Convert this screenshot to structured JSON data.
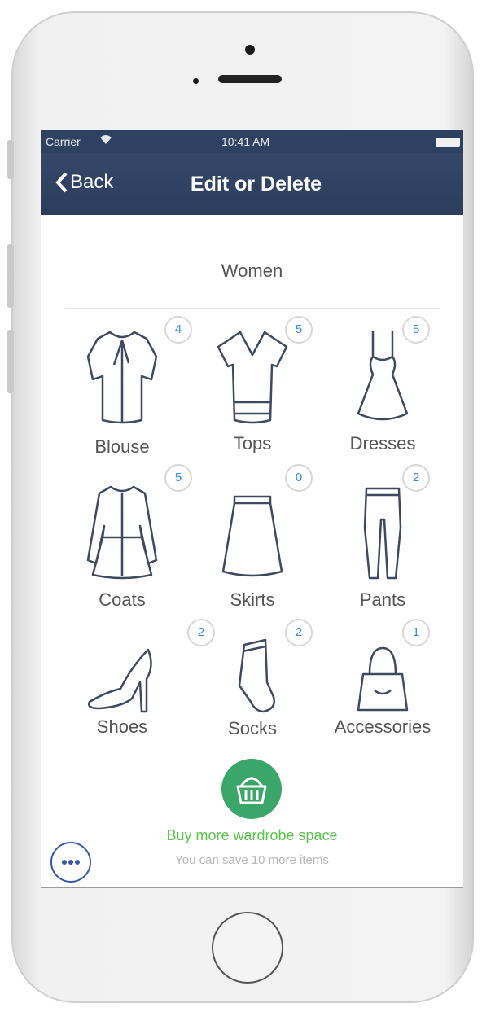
{
  "status": {
    "carrier": "Carrier",
    "wifi_icon": "wifi-icon",
    "time": "10:41 AM",
    "battery_icon": "battery-icon"
  },
  "nav": {
    "back_label": "Back",
    "title": "Edit or Delete"
  },
  "section_title": "Women",
  "items": [
    {
      "label": "Blouse",
      "count": "4",
      "icon": "blouse-icon"
    },
    {
      "label": "Tops",
      "count": "5",
      "icon": "top-icon"
    },
    {
      "label": "Dresses",
      "count": "5",
      "icon": "dress-icon"
    },
    {
      "label": "Coats",
      "count": "5",
      "icon": "coat-icon"
    },
    {
      "label": "Skirts",
      "count": "0",
      "icon": "skirt-icon"
    },
    {
      "label": "Pants",
      "count": "2",
      "icon": "pants-icon"
    },
    {
      "label": "Shoes",
      "count": "2",
      "icon": "shoe-icon"
    },
    {
      "label": "Socks",
      "count": "2",
      "icon": "sock-icon"
    },
    {
      "label": "Accessories",
      "count": "1",
      "icon": "bag-icon"
    }
  ],
  "buy": {
    "label": "Buy more wardrobe space",
    "subtitle": "You can save 10  more items",
    "icon": "basket-icon"
  },
  "colors": {
    "nav": "#2f4160",
    "accent": "#3a8dde",
    "buy_green": "#57c64a",
    "basket_bg": "#3aa66a"
  }
}
